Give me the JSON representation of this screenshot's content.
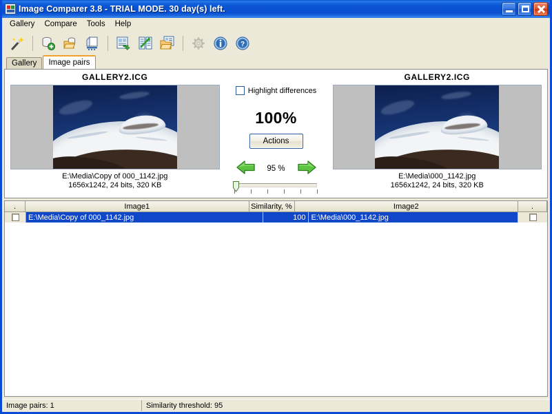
{
  "window": {
    "title": "Image Comparer 3.8 - TRIAL MODE. 30 day(s) left.",
    "icon": "app-icon",
    "buttons": {
      "minimize": "minimize",
      "maximize": "maximize",
      "close": "close"
    }
  },
  "menu": {
    "items": [
      "Gallery",
      "Compare",
      "Tools",
      "Help"
    ]
  },
  "toolbar": {
    "items": [
      {
        "name": "wizard-icon",
        "tip": "Wizard"
      },
      {
        "name": "new-gallery-icon",
        "tip": "New gallery"
      },
      {
        "name": "open-gallery-icon",
        "tip": "Open gallery"
      },
      {
        "name": "scan-images-icon",
        "tip": "Scan images"
      },
      {
        "name": "compare-gallery-icon",
        "tip": "Compare gallery"
      },
      {
        "name": "compare-chart-icon",
        "tip": "Compare two galleries"
      },
      {
        "name": "compare-folders-icon",
        "tip": "Compare folders"
      },
      {
        "name": "settings-gear-icon",
        "tip": "Options"
      },
      {
        "name": "info-icon",
        "tip": "About"
      },
      {
        "name": "help-icon",
        "tip": "Help"
      }
    ]
  },
  "tabs": [
    {
      "label": "Gallery",
      "active": false
    },
    {
      "label": "Image pairs",
      "active": true
    }
  ],
  "compare": {
    "left": {
      "title": "GALLERY2.ICG",
      "path": "E:\\Media\\Copy of 000_1142.jpg",
      "info": "1656x1242, 24 bits, 320 KB"
    },
    "right": {
      "title": "GALLERY2.ICG",
      "path": "E:\\Media\\000_1142.jpg",
      "info": "1656x1242, 24 bits, 320 KB"
    },
    "highlight_label": "Highlight differences",
    "highlight_checked": false,
    "similarity_big": "100%",
    "actions_label": "Actions",
    "prev_arrow": "green-left-arrow",
    "next_arrow": "green-right-arrow",
    "threshold_label": "95 %",
    "slider_value": 0
  },
  "table": {
    "columns": [
      ".",
      "Image1",
      "Similarity, %",
      "Image2",
      "."
    ],
    "rows": [
      {
        "check_left": false,
        "image1": "E:\\Media\\Copy of 000_1142.jpg",
        "similarity": "100",
        "image2": "E:\\Media\\000_1142.jpg",
        "check_right": false,
        "selected": true
      }
    ]
  },
  "status": {
    "pairs": "Image pairs: 1",
    "threshold": "Similarity threshold: 95"
  },
  "colors": {
    "titlebar_blue": "#0a4ad8",
    "selection_blue": "#1046c8",
    "face": "#ece9d8",
    "tab_accent": "#f0a030",
    "arrow_green": "#4db83a"
  }
}
